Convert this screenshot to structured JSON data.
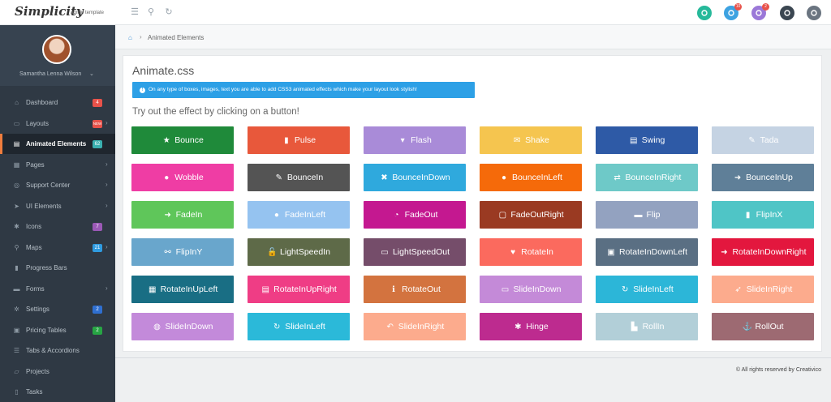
{
  "brand": {
    "name": "Simplicity",
    "sub": "admin template"
  },
  "topbar": {
    "icons": [
      "menu-icon",
      "search-icon",
      "refresh-icon"
    ],
    "actions": [
      {
        "name": "user-icon",
        "color": "#26b99a",
        "badge": ""
      },
      {
        "name": "mail-icon",
        "color": "#3da2e1",
        "badge": "10"
      },
      {
        "name": "info-icon",
        "color": "#9b78d8",
        "badge": "2"
      },
      {
        "name": "gear-icon",
        "color": "#3b4651",
        "badge": ""
      },
      {
        "name": "lock-icon",
        "color": "#6a7480",
        "badge": ""
      }
    ]
  },
  "profile": {
    "name": "Samantha Lenna Wilson"
  },
  "sidebar": {
    "items": [
      {
        "label": "Dashboard",
        "icon": "home-icon",
        "glyph": "⌂",
        "badge": "4",
        "badge_color": "#e8524a",
        "chevron": false,
        "active": false
      },
      {
        "label": "Layouts",
        "icon": "monitor-icon",
        "glyph": "▭",
        "badge": "NEW",
        "badge_color": "#e8524a",
        "chevron": true,
        "active": false
      },
      {
        "label": "Animated Elements",
        "icon": "css3-icon",
        "glyph": "▤",
        "badge": "62",
        "badge_color": "#3ab0b0",
        "chevron": false,
        "active": true
      },
      {
        "label": "Pages",
        "icon": "pages-icon",
        "glyph": "▦",
        "badge": "",
        "badge_color": "",
        "chevron": true,
        "active": false
      },
      {
        "label": "Support Center",
        "icon": "support-icon",
        "glyph": "◎",
        "badge": "",
        "badge_color": "",
        "chevron": true,
        "active": false
      },
      {
        "label": "UI Elements",
        "icon": "send-icon",
        "glyph": "➤",
        "badge": "",
        "badge_color": "",
        "chevron": true,
        "active": false
      },
      {
        "label": "Icons",
        "icon": "asterisk-icon",
        "glyph": "✱",
        "badge": "7",
        "badge_color": "#9b59b6",
        "chevron": false,
        "active": false
      },
      {
        "label": "Maps",
        "icon": "map-marker-icon",
        "glyph": "⚲",
        "badge": "21",
        "badge_color": "#2f9be0",
        "chevron": true,
        "active": false
      },
      {
        "label": "Progress Bars",
        "icon": "bar-chart-icon",
        "glyph": "▮",
        "badge": "",
        "badge_color": "",
        "chevron": false,
        "active": false
      },
      {
        "label": "Forms",
        "icon": "folder-icon",
        "glyph": "▬",
        "badge": "",
        "badge_color": "",
        "chevron": true,
        "active": false
      },
      {
        "label": "Settings",
        "icon": "cogs-icon",
        "glyph": "✲",
        "badge": "2",
        "badge_color": "#2f6fd0",
        "chevron": false,
        "active": false
      },
      {
        "label": "Pricing Tables",
        "icon": "calendar-icon",
        "glyph": "▣",
        "badge": "2",
        "badge_color": "#27a544",
        "chevron": false,
        "active": false
      },
      {
        "label": "Tabs & Accordions",
        "icon": "list-icon",
        "glyph": "☰",
        "badge": "",
        "badge_color": "",
        "chevron": false,
        "active": false
      },
      {
        "label": "Projects",
        "icon": "folder-open-icon",
        "glyph": "▱",
        "badge": "",
        "badge_color": "",
        "chevron": false,
        "active": false
      },
      {
        "label": "Tasks",
        "icon": "document-icon",
        "glyph": "▯",
        "badge": "",
        "badge_color": "",
        "chevron": false,
        "active": false
      }
    ]
  },
  "breadcrumb": {
    "label": "Animated Elements"
  },
  "panel": {
    "title": "Animate.css",
    "info": "On any type of boxes, images, text you are able to add CSS3 animated effects which make your layout look stylish!",
    "subtitle": "Try out the effect by clicking on a button!"
  },
  "buttons": [
    {
      "label": "Bounce",
      "color": "#1f8a3a",
      "icon": "star-icon",
      "glyph": "★"
    },
    {
      "label": "Pulse",
      "color": "#e8583b",
      "icon": "signal-icon",
      "glyph": "▮"
    },
    {
      "label": "Flash",
      "color": "#a98bd8",
      "icon": "bookmark-icon",
      "glyph": "▾"
    },
    {
      "label": "Shake",
      "color": "#f5c54f",
      "icon": "envelope-icon",
      "glyph": "✉"
    },
    {
      "label": "Swing",
      "color": "#2e5aa6",
      "icon": "briefcase-icon",
      "glyph": "▤"
    },
    {
      "label": "Tada",
      "color": "#c5d3e3",
      "icon": "magic-icon",
      "glyph": "✎"
    },
    {
      "label": "Wobble",
      "color": "#ef3da4",
      "icon": "map-marker-icon",
      "glyph": "●"
    },
    {
      "label": "BounceIn",
      "color": "#545454",
      "icon": "pencil-icon",
      "glyph": "✎"
    },
    {
      "label": "BounceInDown",
      "color": "#2fa9dd",
      "icon": "times-icon",
      "glyph": "✖"
    },
    {
      "label": "BounceInLeft",
      "color": "#f56a0a",
      "icon": "exclamation-icon",
      "glyph": "●"
    },
    {
      "label": "BounceInRight",
      "color": "#6ec9c8",
      "icon": "exchange-icon",
      "glyph": "⇄"
    },
    {
      "label": "BounceInUp",
      "color": "#5f7f98",
      "icon": "sign-in-icon",
      "glyph": "➜"
    },
    {
      "label": "FadeIn",
      "color": "#5fc65a",
      "icon": "sign-out-icon",
      "glyph": "➜"
    },
    {
      "label": "FadeInLeft",
      "color": "#95c3f0",
      "icon": "user-icon",
      "glyph": "●"
    },
    {
      "label": "FadeOut",
      "color": "#c41890",
      "icon": "dashboard-icon",
      "glyph": "◔"
    },
    {
      "label": "FadeOutRight",
      "color": "#9a3a22",
      "icon": "square-icon",
      "glyph": "▢"
    },
    {
      "label": "Flip",
      "color": "#93a2c0",
      "icon": "folder-icon",
      "glyph": "▬"
    },
    {
      "label": "FlipInX",
      "color": "#4fc5c6",
      "icon": "file-icon",
      "glyph": "▮"
    },
    {
      "label": "FlipInY",
      "color": "#69a6cc",
      "icon": "unlink-icon",
      "glyph": "⚯"
    },
    {
      "label": "LightSpeedIn",
      "color": "#5e6a48",
      "icon": "unlock-icon",
      "glyph": "🔓"
    },
    {
      "label": "LightSpeedOut",
      "color": "#754d6a",
      "icon": "inbox-icon",
      "glyph": "▭"
    },
    {
      "label": "RotateIn",
      "color": "#fb6a5e",
      "icon": "heart-icon",
      "glyph": "♥"
    },
    {
      "label": "RotateInDownLeft",
      "color": "#5a6f83",
      "icon": "save-icon",
      "glyph": "▣"
    },
    {
      "label": "RotateInDownRight",
      "color": "#e3173e",
      "icon": "sign-in-icon",
      "glyph": "➜"
    },
    {
      "label": "RotateInUpLeft",
      "color": "#196e84",
      "icon": "building-icon",
      "glyph": "▦"
    },
    {
      "label": "RotateInUpRight",
      "color": "#ef3d85",
      "icon": "hdd-icon",
      "glyph": "▤"
    },
    {
      "label": "RotateOut",
      "color": "#d3733f",
      "icon": "info-icon",
      "glyph": "ℹ"
    },
    {
      "label": "SlideInDown",
      "color": "#c48ad8",
      "icon": "inbox-icon",
      "glyph": "▭"
    },
    {
      "label": "SlideInLeft",
      "color": "#2cb6d8",
      "icon": "refresh-icon",
      "glyph": "↻"
    },
    {
      "label": "SlideInRight",
      "color": "#fcab8d",
      "icon": "rocket-icon",
      "glyph": "➶"
    },
    {
      "label": "SlideInDown",
      "color": "#c38ada",
      "icon": "gamepad-icon",
      "glyph": "◍"
    },
    {
      "label": "SlideInLeft",
      "color": "#2bb9d9",
      "icon": "refresh-icon",
      "glyph": "↻"
    },
    {
      "label": "SlideInRight",
      "color": "#fcab8d",
      "icon": "reply-icon",
      "glyph": "↶"
    },
    {
      "label": "Hinge",
      "color": "#bd2b8f",
      "icon": "cog-icon",
      "glyph": "✱"
    },
    {
      "label": "RollIn",
      "color": "#b2cfd8",
      "icon": "truck-icon",
      "glyph": "▙"
    },
    {
      "label": "RollOut",
      "color": "#9d6a72",
      "icon": "anchor-icon",
      "glyph": "⚓"
    }
  ],
  "footer": {
    "text": "© All rights reserved by Creativico"
  }
}
